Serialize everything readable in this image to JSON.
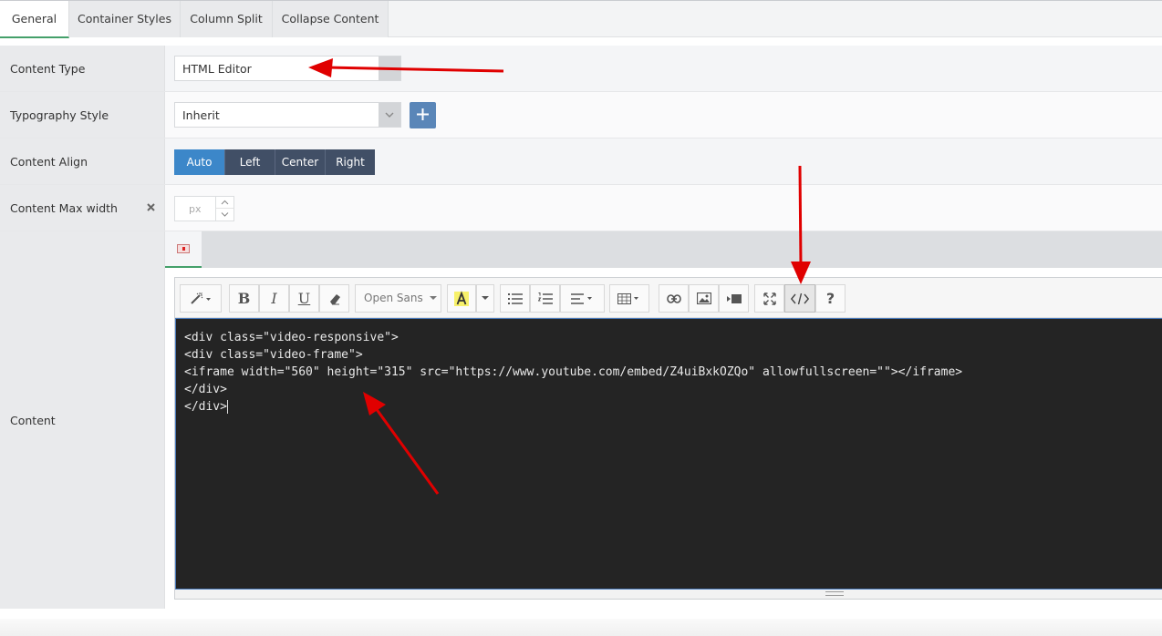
{
  "tabs": [
    {
      "label": "General",
      "active": true
    },
    {
      "label": "Container Styles",
      "active": false
    },
    {
      "label": "Column Split",
      "active": false
    },
    {
      "label": "Collapse Content",
      "active": false
    }
  ],
  "fields": {
    "content_type": {
      "label": "Content Type",
      "value": "HTML Editor"
    },
    "typography_style": {
      "label": "Typography Style",
      "value": "Inherit",
      "add_icon": "plus-icon"
    },
    "content_align": {
      "label": "Content Align",
      "options": [
        "Auto",
        "Left",
        "Center",
        "Right"
      ],
      "selected": "Auto"
    },
    "content_max_width": {
      "label": "Content Max width",
      "placeholder": "px",
      "clear_icon": "close-icon"
    },
    "content": {
      "label": "Content"
    }
  },
  "editor": {
    "font_select": "Open Sans",
    "code_lines": [
      "<div class=\"video-responsive\">",
      "<div class=\"video-frame\">",
      "<iframe width=\"560\" height=\"315\" src=\"https://www.youtube.com/embed/Z4uiBxkOZQo\" allowfullscreen=\"\"></iframe>",
      "</div>",
      "</div>"
    ],
    "help_label": "?"
  },
  "colors": {
    "active_tab_underline": "#44a06a",
    "align_active": "#3c87c9",
    "align_inactive": "#414f66",
    "plus_button": "#5a86b8",
    "code_bg": "#242424",
    "annotation_arrow": "#e00000"
  }
}
